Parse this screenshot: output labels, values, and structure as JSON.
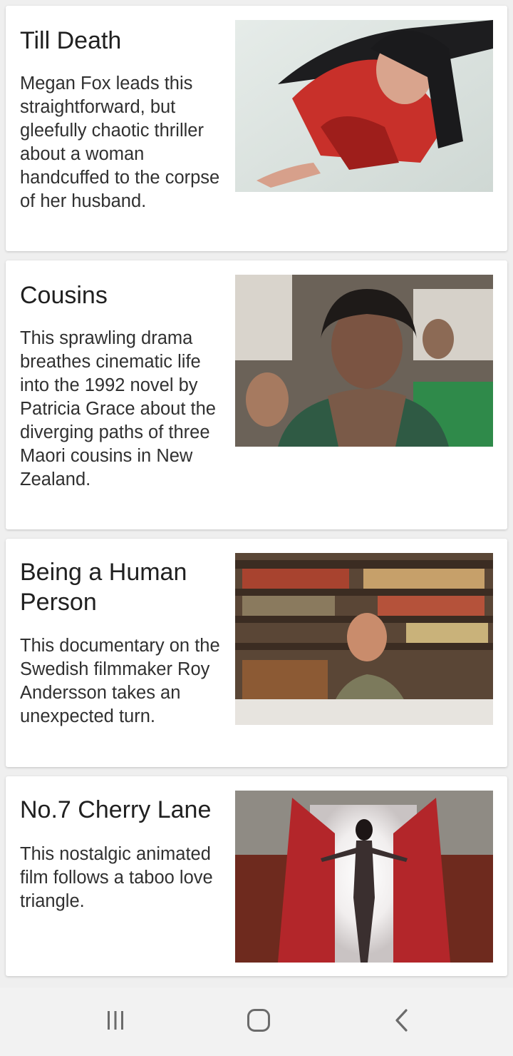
{
  "cards": [
    {
      "title": "Till Death",
      "description": "Megan Fox leads this straightforward, but gleefully chaotic thriller about a woman handcuffed to the corpse of her husband.",
      "image_icon": "movie-still"
    },
    {
      "title": "Cousins",
      "description": "This sprawling drama breathes cinematic life into the 1992 novel by Patricia Grace about the diverging paths of three Maori cousins in New Zealand.",
      "image_icon": "movie-still"
    },
    {
      "title": "Being a Human Person",
      "description": "This documentary on the Swedish filmmaker Roy Andersson takes an unexpected turn.",
      "image_icon": "movie-still"
    },
    {
      "title": "No.7 Cherry Lane",
      "description": "This nostalgic animated film follows a taboo love triangle.",
      "image_icon": "movie-still"
    }
  ],
  "navbar": {
    "recents_icon": "recent-apps-icon",
    "home_icon": "home-icon",
    "back_icon": "back-icon"
  }
}
